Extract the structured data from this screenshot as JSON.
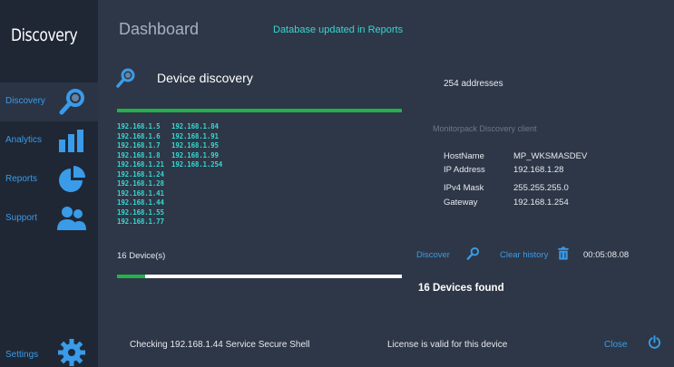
{
  "app": {
    "title": "Discovery"
  },
  "sidebar": {
    "items": [
      {
        "label": "Discovery",
        "icon": "search-icon"
      },
      {
        "label": "Analytics",
        "icon": "bar-chart-icon"
      },
      {
        "label": "Reports",
        "icon": "pie-chart-icon"
      },
      {
        "label": "Support",
        "icon": "users-icon"
      }
    ],
    "settings": {
      "label": "Settings",
      "icon": "gear-icon"
    }
  },
  "header": {
    "title": "Dashboard",
    "notification": "Database updated in Reports"
  },
  "discovery": {
    "title": "Device discovery",
    "address_count": "254 addresses",
    "scan_progress": 1.0,
    "ips_col1": [
      "192.168.1.5",
      "192.168.1.6",
      "192.168.1.7",
      "192.168.1.8",
      "192.168.1.21",
      "192.168.1.24",
      "192.168.1.28",
      "192.168.1.41",
      "192.168.1.44",
      "192.168.1.55",
      "192.168.1.77"
    ],
    "ips_col2": [
      "192.168.1.84",
      "192.168.1.91",
      "192.168.1.95",
      "192.168.1.99",
      "192.168.1.254"
    ]
  },
  "client": {
    "title": "Monitorpack Discovery client",
    "rows": [
      {
        "label": "HostName",
        "value": "MP_WKSMASDEV"
      },
      {
        "label": "IP Address",
        "value": "192.168.1.28"
      },
      {
        "label": "IPv4 Mask",
        "value": "255.255.255.0"
      },
      {
        "label": "Gateway",
        "value": "192.168.1.254"
      }
    ]
  },
  "actions": {
    "devices_count": "16 Device(s)",
    "discover_label": "Discover",
    "clear_label": "Clear history",
    "timer": "00:05:08.08",
    "progress": 0.1,
    "found_text": "16 Devices found"
  },
  "footer": {
    "status": "Checking 192.168.1.44 Service Secure Shell",
    "license": "License is valid for this device",
    "close_label": "Close"
  },
  "colors": {
    "accent": "#3a9be8",
    "cyan": "#37d6d0",
    "green": "#24b14a",
    "sidebar_bg": "#1f2735",
    "main_bg": "#2e3747"
  }
}
